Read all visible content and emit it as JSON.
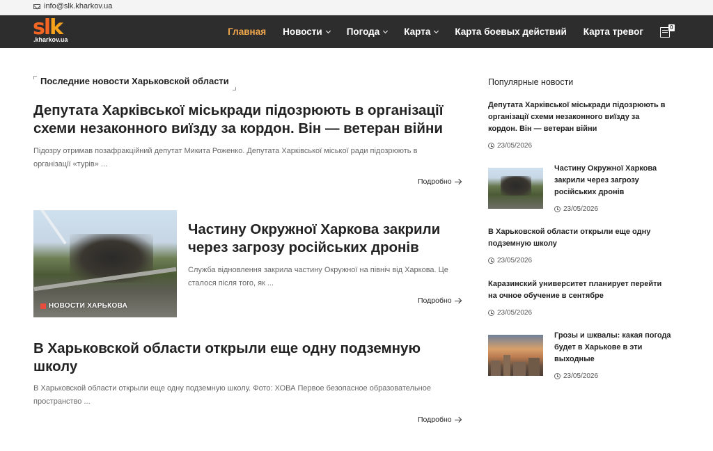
{
  "topbar": {
    "email": "info@slk.kharkov.ua"
  },
  "logo": {
    "main_s": "sl",
    "main_k": "k",
    "sub": ".kharkov.ua"
  },
  "nav": {
    "items": [
      {
        "label": "Главная",
        "active": true,
        "dropdown": false
      },
      {
        "label": "Новости",
        "active": false,
        "dropdown": true
      },
      {
        "label": "Погода",
        "active": false,
        "dropdown": true
      },
      {
        "label": "Карта",
        "active": false,
        "dropdown": true
      },
      {
        "label": "Карта боевых действий",
        "active": false,
        "dropdown": false
      },
      {
        "label": "Карта тревог",
        "active": false,
        "dropdown": false
      }
    ],
    "bookmark_count": "0",
    "accent_color": "#f0a64b"
  },
  "main": {
    "section_title": "Последние новости Харьковской области",
    "more_label": "Подробно",
    "articles": [
      {
        "title": "Депутата Харківської міськради підозрюють в організації схеми незаконного виїзду за кордон. Він — ветеран війни",
        "excerpt": "Підозру отримав позафракційний депутат Микита Роженко. Депутата Харківської міської ради підозрюють в організації «турів» ..."
      },
      {
        "title": "Частину Окружної Харкова закрили через загрозу російських дронів",
        "excerpt": "Служба відновлення закрила частину Окружної на північ від Харкова.  Це сталося після того, як ...",
        "category": "НОВОСТИ ХАРЬКОВА"
      },
      {
        "title": "В Харьковской области открыли еще одну подземную школу",
        "excerpt": "В Харьковской области открыли еще одну подземную школу. Фото: ХОВА Первое безопасное образовательное пространство ..."
      }
    ]
  },
  "sidebar": {
    "title": "Популярные новости",
    "items": [
      {
        "title": "Депутата Харківської міськради підозрюють в організації схеми незаконного виїзду за кордон. Він — ветеран війни",
        "date": "23/05/2026"
      },
      {
        "title": "Частину Окружної Харкова закрили через загрозу російських дронів",
        "date": "23/05/2026"
      },
      {
        "title": "В Харьковской области открыли еще одну подземную школу",
        "date": "23/05/2026"
      },
      {
        "title": "Каразинский университет планирует перейти на очное обучение в сентябре",
        "date": "23/05/2026"
      },
      {
        "title": "Грозы и шквалы: какая погода будет в Харькове в эти выходные",
        "date": "23/05/2026"
      }
    ]
  }
}
